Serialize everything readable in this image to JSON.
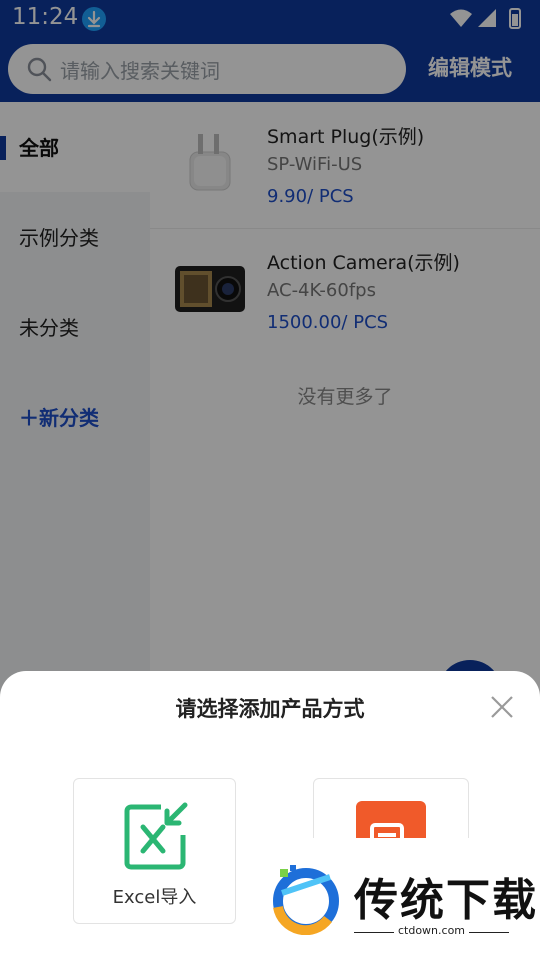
{
  "status_bar": {
    "time": "11:24"
  },
  "header": {
    "search_placeholder": "请输入搜索关键词",
    "edit_mode": "编辑模式"
  },
  "sidebar": {
    "items": [
      {
        "label": "全部",
        "active": true
      },
      {
        "label": "示例分类",
        "active": false
      },
      {
        "label": "未分类",
        "active": false
      },
      {
        "label": "＋新分类",
        "active": false
      }
    ]
  },
  "products": [
    {
      "name": "Smart Plug(示例)",
      "sku": "SP-WiFi-US",
      "price": "9.90/ PCS",
      "icon": "smart-plug-image"
    },
    {
      "name": "Action Camera(示例)",
      "sku": "AC-4K-60fps",
      "price": "1500.00/ PCS",
      "icon": "action-camera-image"
    }
  ],
  "list_footer": "没有更多了",
  "sheet": {
    "title": "请选择添加产品方式",
    "options": [
      {
        "label": "Excel导入",
        "icon": "excel-import-icon"
      },
      {
        "label": "",
        "icon": "manual-add-icon"
      }
    ]
  },
  "watermark": {
    "title": "传统下载",
    "url": "ctdown.com"
  },
  "colors": {
    "brand": "#0f3a9e",
    "price": "#1e4fc9",
    "excel_green": "#2bb673",
    "manual_orange": "#f05a2a"
  }
}
